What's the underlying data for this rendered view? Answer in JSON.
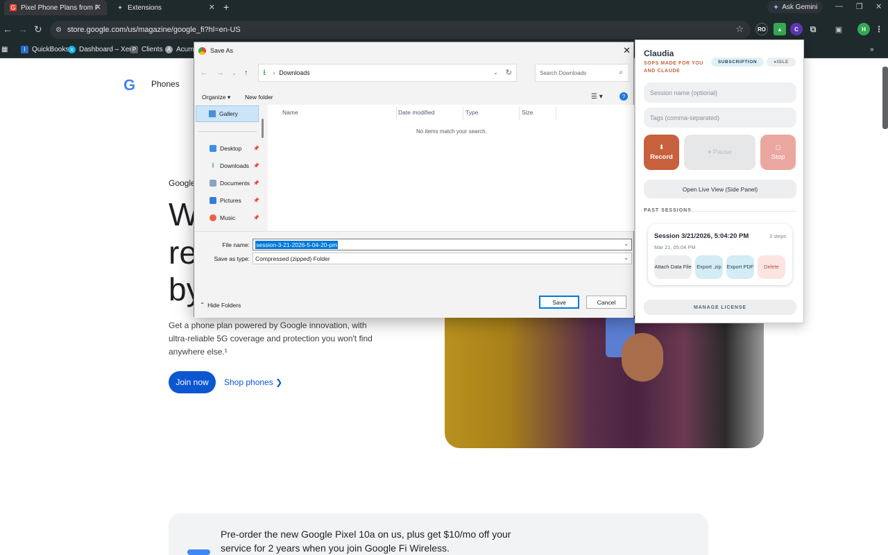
{
  "browser": {
    "tabs": [
      {
        "label": "Pixel Phone Plans from Fi - Goo",
        "active": true
      },
      {
        "label": "Extensions",
        "active": false
      }
    ],
    "ask_gemini": "Ask Gemini",
    "url": "store.google.com/us/magazine/google_fi?hl=en-US",
    "extensions": [
      "RO",
      "C",
      "H"
    ],
    "bookmarks": [
      "QuickBooks",
      "Dashboard – Xero",
      "Clients",
      "Acumat"
    ]
  },
  "page": {
    "nav_phones": "Phones",
    "eyebrow": "Google",
    "hero_fragments": [
      "W",
      "re",
      "by"
    ],
    "description": "Get a phone plan powered by Google innovation, with ultra-reliable 5G coverage and protection you won't find anywhere else.¹",
    "join_now": "Join now",
    "shop_phones": "Shop phones",
    "promo": "Pre-order the new Google Pixel 10a on us, plus get $10/mo off your service for 2 years when you join Google Fi Wireless."
  },
  "dialog": {
    "title": "Save As",
    "breadcrumb": "Downloads",
    "search_placeholder": "Search Downloads",
    "organize": "Organize",
    "new_folder": "New folder",
    "nav_items": [
      {
        "label": "Gallery"
      },
      {
        "label": "Desktop"
      },
      {
        "label": "Downloads"
      },
      {
        "label": "Documents"
      },
      {
        "label": "Pictures"
      },
      {
        "label": "Music"
      }
    ],
    "columns": [
      "Name",
      "Date modified",
      "Type",
      "Size"
    ],
    "empty_text": "No items match your search.",
    "file_name_label": "File name:",
    "file_name": "session-3-21-2026-5-04-20-pm",
    "save_type_label": "Save as type:",
    "save_type": "Compressed (zipped) Folder",
    "hide_folders": "Hide Folders",
    "save": "Save",
    "cancel": "Cancel"
  },
  "popup": {
    "title": "Claudia",
    "subtitle": "SOPS MADE FOR YOU AND CLAUDE",
    "badge_subscription": "SUBSCRIPTION",
    "badge_idle": "IDLE",
    "session_placeholder": "Session name (optional)",
    "tags_placeholder": "Tags (comma-separated)",
    "record": "Record",
    "pause": "Pause",
    "stop": "Stop",
    "live_view": "Open Live View (Side Panel)",
    "past_sessions": "PAST SESSIONS",
    "session": {
      "title": "Session 3/21/2026, 5:04:20 PM",
      "steps": "3 steps",
      "date": "Mar 21, 05:04 PM",
      "attach": "Attach Data File",
      "export_zip": "Export .zip",
      "export_pdf": "Export PDF",
      "delete": "Delete"
    },
    "manage_license": "MANAGE LICENSE"
  },
  "colors": {
    "chrome_dark": "#1f2a2d",
    "google_blue": "#0b57d0",
    "record_orange": "#c6603d",
    "selection_blue": "#0078d7"
  }
}
